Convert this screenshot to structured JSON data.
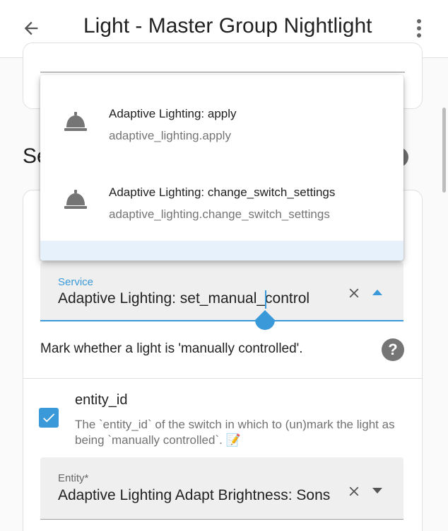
{
  "header": {
    "title": "Light - Master Group Nightlight"
  },
  "section_peek": {
    "text": "Se"
  },
  "dropdown": {
    "options": [
      {
        "primary": "Adaptive Lighting: apply",
        "secondary": "adaptive_lighting.apply",
        "icon": "bell-icon"
      },
      {
        "primary": "Adaptive Lighting: change_switch_settings",
        "secondary": "adaptive_lighting.change_switch_settings",
        "icon": "bell-icon"
      }
    ]
  },
  "service": {
    "label": "Service",
    "value": "Adaptive Lighting: set_manual_control",
    "description": "Mark whether a light is 'manually controlled'.",
    "help": "?"
  },
  "entity": {
    "name": "entity_id",
    "description": "The `entity_id` of the switch in which to (un)mark the light as being `manually controlled`. 📝",
    "checked": true,
    "field_label": "Entity*",
    "field_value": "Adaptive Lighting Adapt Brightness: Sons"
  },
  "colors": {
    "accent": "#3a99d8",
    "highlight": "#e6f1fb"
  }
}
